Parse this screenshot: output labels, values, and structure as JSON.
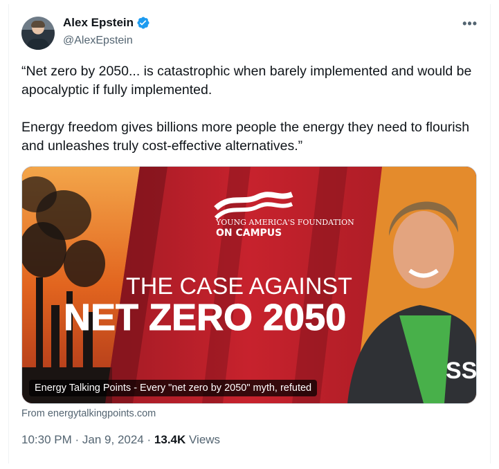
{
  "author": {
    "display_name": "Alex Epstein",
    "handle": "@AlexEpstein"
  },
  "tweet": {
    "paragraph_1": "“Net zero by 2050... is catastrophic when barely implemented and would be apocalyptic if fully implemented.",
    "paragraph_2": "Energy freedom gives billions more people the energy they need to flourish and unleashes truly cost-effective alternatives.”"
  },
  "media": {
    "org_name": "YOUNG AMERICA'S FOUNDATION",
    "org_sub": "ON CAMPUS",
    "headline_1": "THE CASE AGAINST",
    "headline_2": "NET ZERO 2050",
    "shirt_text": "SSI",
    "caption": "Energy Talking Points - Every \"net zero by 2050\" myth, refuted"
  },
  "source": "From energytalkingpoints.com",
  "meta": {
    "time": "10:30 PM",
    "date": "Jan 9, 2024",
    "views_count": "13.4K",
    "views_label": "Views",
    "separator": "·"
  },
  "icons": {
    "verified": "verified-badge-icon",
    "more": "more-options-icon"
  },
  "colors": {
    "verified_blue": "#1d9bf0",
    "text": "#0f1419",
    "secondary": "#536471",
    "media_red": "#b81f2a"
  }
}
